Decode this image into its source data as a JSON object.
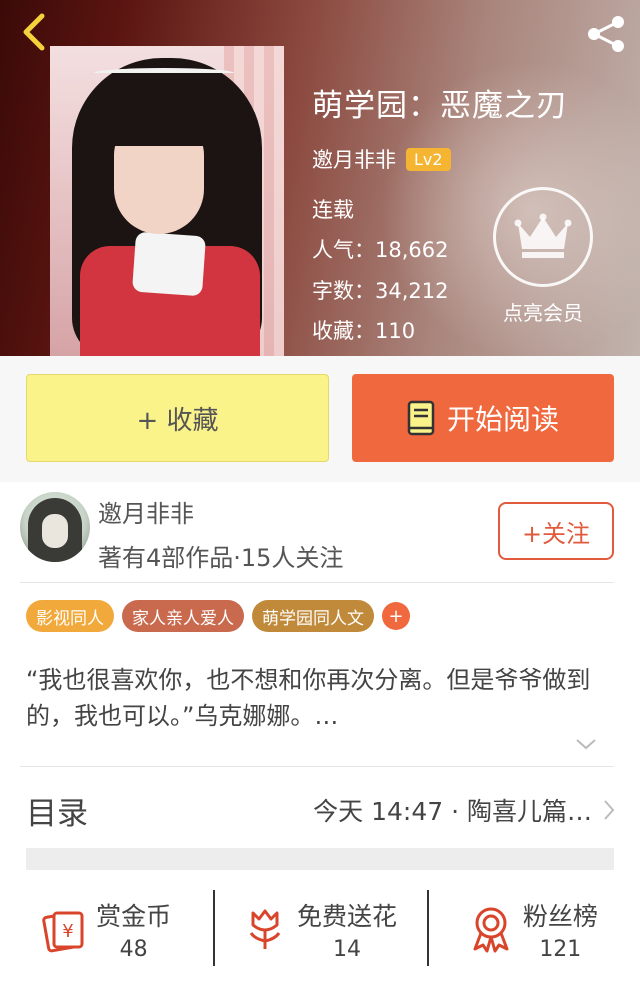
{
  "book": {
    "title": "萌学园：恶魔之刃",
    "author": "邀月非非",
    "level": "Lv2",
    "status": "连载",
    "popularity": "人气：18,662",
    "word_count": "字数：34,212",
    "favorites": "收藏：110",
    "vip_label": "点亮会员"
  },
  "actions": {
    "favorite_label": "+ 收藏",
    "read_label": "开始阅读"
  },
  "author_card": {
    "name": "邀月非非",
    "meta": "著有4部作品·15人关注",
    "follow_label": "+关注"
  },
  "tags": [
    {
      "label": "影视同人",
      "color": "#f2a93b"
    },
    {
      "label": "家人亲人爱人",
      "color": "#c96a4e"
    },
    {
      "label": "萌学园同人文",
      "color": "#c08a3a"
    }
  ],
  "tag_more": "+",
  "intro": "“我也很喜欢你，也不想和你再次分离。但是爷爷做到的，我也可以。”乌克娜娜。…",
  "toc": {
    "title": "目录",
    "latest": "今天 14:47 · 陶喜儿篇…"
  },
  "bottom": [
    {
      "label": "赏金币",
      "value": "48",
      "icon": "reward-coin-icon"
    },
    {
      "label": "免费送花",
      "value": "14",
      "icon": "flower-icon"
    },
    {
      "label": "粉丝榜",
      "value": "121",
      "icon": "medal-icon"
    }
  ],
  "colors": {
    "accent": "#f0683d",
    "favorite_bg": "#faf38a",
    "icon_red": "#d9452b",
    "level_badge": "#f5b432"
  }
}
